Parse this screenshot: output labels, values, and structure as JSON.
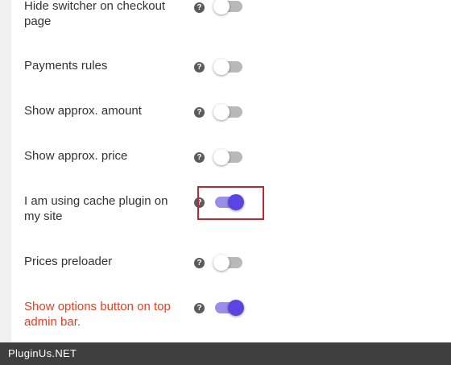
{
  "settings": [
    {
      "label": "Hide switcher on checkout page",
      "help_icon": "question-icon",
      "enabled": false,
      "label_color": "#333333"
    },
    {
      "label": "Payments rules",
      "help_icon": "question-icon",
      "enabled": false,
      "label_color": "#333333"
    },
    {
      "label": "Show approx. amount",
      "help_icon": "question-icon",
      "enabled": false,
      "label_color": "#333333"
    },
    {
      "label": "Show approx. price",
      "help_icon": "question-icon",
      "enabled": false,
      "label_color": "#333333"
    },
    {
      "label": "I am using cache plugin on my site",
      "help_icon": "question-icon",
      "enabled": true,
      "highlighted": true,
      "label_color": "#333333"
    },
    {
      "label": "Prices preloader",
      "help_icon": "question-icon",
      "enabled": false,
      "label_color": "#333333"
    },
    {
      "label": "Show options button on top admin bar.",
      "help_icon": "question-icon",
      "enabled": true,
      "label_color": "#f13b1c"
    }
  ],
  "help_glyph": "?",
  "footer": {
    "watermark": "PluginUs.NET"
  },
  "colors": {
    "toggle_on_track": "#9a8ee8",
    "toggle_on_knob": "#5b45e0",
    "toggle_off_track": "#b9b9b9",
    "highlight_border": "#c0262d",
    "footer_bg": "#3f3f3f"
  }
}
